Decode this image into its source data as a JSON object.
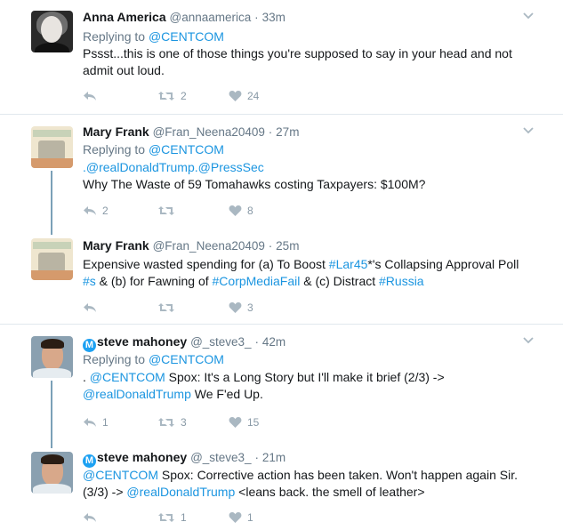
{
  "tweets": [
    {
      "name": "Anna America",
      "handle": "@annaamerica",
      "dot": "·",
      "time": "33m",
      "replying_prefix": "Replying to",
      "replying_to": "@CENTCOM",
      "text_line1": "Pssst...this is one of those things you're supposed to say in your head and not",
      "text_line2": "admit out loud.",
      "reply_count": "",
      "retweet_count": "2",
      "like_count": "24"
    },
    {
      "name": "Mary Frank",
      "handle": "@Fran_Neena20409",
      "dot": "·",
      "time": "27m",
      "replying_prefix": "Replying to",
      "replying_to": "@CENTCOM",
      "mention1": ".@realDonaldTrump",
      "mention2": ".@PressSec",
      "text_line2": "Why The Waste of 59 Tomahawks costing Taxpayers: $100M?",
      "reply_count": "2",
      "retweet_count": "",
      "like_count": "8"
    },
    {
      "name": "Mary Frank",
      "handle": "@Fran_Neena20409",
      "dot": "·",
      "time": "25m",
      "t1": "Expensive wasted spending for (a) To Boost ",
      "h1": "#Lar45",
      "t2": "*'s Collapsing Approval Poll",
      "h2": "#s",
      "t3": " & (b) for Fawning of ",
      "h3": "#CorpMediaFail",
      "t4": " & (c) Distract ",
      "h4": "#Russia",
      "reply_count": "",
      "retweet_count": "",
      "like_count": "3"
    },
    {
      "name": "steve mahoney",
      "handle": "@_steve3_",
      "dot": "·",
      "time": "42m",
      "replying_prefix": "Replying to",
      "replying_to": "@CENTCOM",
      "t0": ". ",
      "m1": "@CENTCOM",
      "t1": " Spox:  It's a Long Story but I'll make it brief (2/3) ->",
      "m2": "@realDonaldTrump",
      "t2": "  We F'ed Up.",
      "reply_count": "1",
      "retweet_count": "3",
      "like_count": "15"
    },
    {
      "name": "steve mahoney",
      "handle": "@_steve3_",
      "dot": "·",
      "time": "21m",
      "m1": "@CENTCOM",
      "t1": " Spox:  Corrective action has been taken.  Won't happen again Sir.",
      "t2": "(3/3) -> ",
      "m2": "@realDonaldTrump",
      "t3": "  <leans back. the smell of leather>",
      "reply_count": "",
      "retweet_count": "1",
      "like_count": "1"
    }
  ],
  "colors": {
    "link": "#1b95e0",
    "muted": "#657786",
    "icon": "#aab8c2",
    "verified": "#1da1f2",
    "thread_line": "#7ba0b8"
  },
  "icons": [
    "reply-icon",
    "retweet-icon",
    "like-icon",
    "chevron-down-icon",
    "verified-badge-icon"
  ]
}
